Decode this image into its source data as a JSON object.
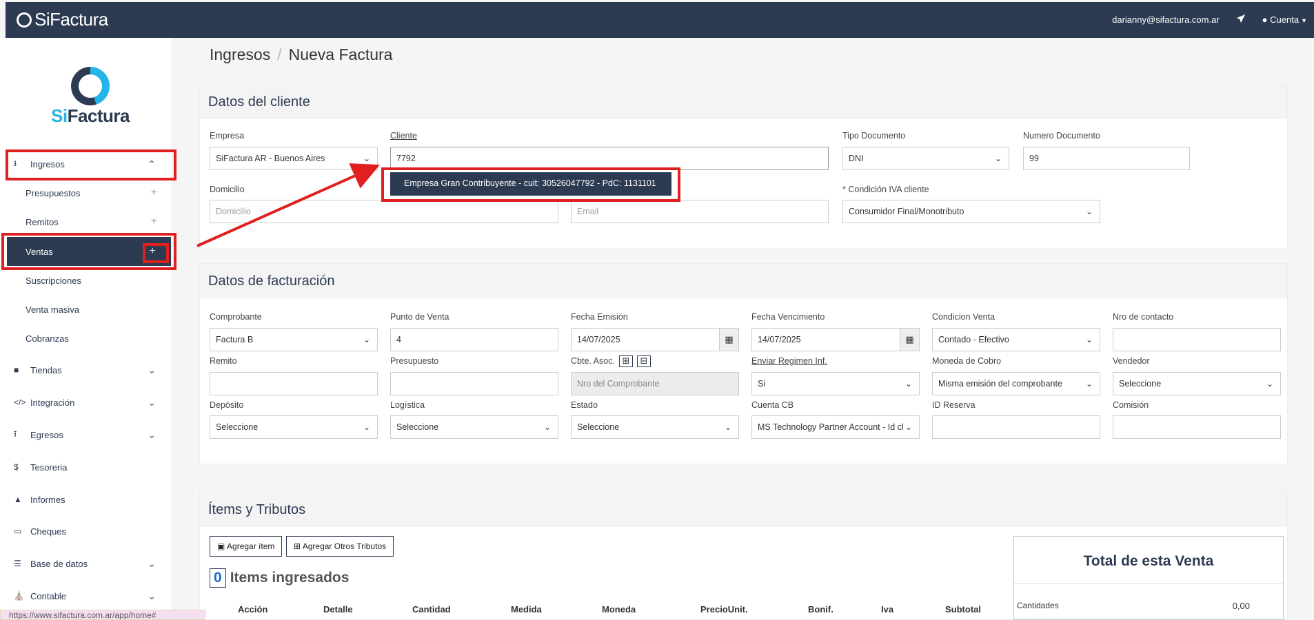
{
  "topbar": {
    "brand": "SiFactura",
    "email": "darianny@sifactura.com.ar",
    "account_label": "Cuenta"
  },
  "sidebar": {
    "logo_si": "Si",
    "logo_rest": "Factura",
    "items": [
      {
        "label": "Ingresos"
      },
      {
        "label": "Presupuestos"
      },
      {
        "label": "Remitos"
      },
      {
        "label": "Ventas"
      },
      {
        "label": "Suscripciones"
      },
      {
        "label": "Venta masiva"
      },
      {
        "label": "Cobranzas"
      },
      {
        "label": "Tiendas"
      },
      {
        "label": "Integración"
      },
      {
        "label": "Egresos"
      },
      {
        "label": "Tesoreria"
      },
      {
        "label": "Informes"
      },
      {
        "label": "Cheques"
      },
      {
        "label": "Base de datos"
      },
      {
        "label": "Contable"
      }
    ]
  },
  "breadcrumb": {
    "parent": "Ingresos",
    "current": "Nueva Factura"
  },
  "cliente": {
    "title": "Datos del cliente",
    "empresa_label": "Empresa",
    "empresa_value": "SiFactura AR - Buenos Aires",
    "cliente_label": "Cliente",
    "cliente_value": "7792",
    "tipo_doc_label": "Tipo Documento",
    "tipo_doc_value": "DNI",
    "num_doc_label": "Numero Documento",
    "num_doc_value": "99",
    "domicilio_label": "Domicilio",
    "domicilio_placeholder": "Domicilio",
    "email_placeholder": "Email",
    "iva_label": "* Condición IVA cliente",
    "iva_value": "Consumidor Final/Monotributo",
    "suggestion_prefix": "Empresa Gran Contribuyente - cuit: 30526047792 - PdC: 1131101"
  },
  "facturacion": {
    "title": "Datos de facturación",
    "comprobante_label": "Comprobante",
    "comprobante_value": "Factura B",
    "punto_venta_label": "Punto de Venta",
    "punto_venta_value": "4",
    "fecha_emision_label": "Fecha Emisión",
    "fecha_emision_value": "14/07/2025",
    "fecha_venc_label": "Fecha Vencimiento",
    "fecha_venc_value": "14/07/2025",
    "cond_venta_label": "Condicion Venta",
    "cond_venta_value": "Contado - Efectivo",
    "nro_contacto_label": "Nro de contacto",
    "remito_label": "Remito",
    "presupuesto_label": "Presupuesto",
    "cbte_asoc_label": "Cbte. Asoc.",
    "cbte_asoc_placeholder": "Nro del Comprobante",
    "regimen_label": "Enviar Regimen Inf.",
    "regimen_value": "Si",
    "moneda_label": "Moneda de Cobro",
    "moneda_value": "Misma emisión del comprobante",
    "vendedor_label": "Vendedor",
    "vendedor_value": "Seleccione",
    "deposito_label": "Depósito",
    "deposito_value": "Seleccione",
    "logistica_label": "Logística",
    "logistica_value": "Seleccione",
    "estado_label": "Estado",
    "estado_value": "Seleccione",
    "cuenta_cb_label": "Cuenta CB",
    "cuenta_cb_value": "MS Technology Partner Account - Id cl",
    "id_reserva_label": "ID Reserva",
    "comision_label": "Comisión"
  },
  "items": {
    "title": "Ítems y Tributos",
    "add_item": "Agregar ítem",
    "add_tributos": "Agregar Otros Tributos",
    "count": "0",
    "count_label": "Items ingresados",
    "columns": [
      "Acción",
      "Detalle",
      "Cantidad",
      "Medida",
      "Moneda",
      "PrecioUnit.",
      "Bonif.",
      "Iva",
      "Subtotal"
    ]
  },
  "totals": {
    "title": "Total de esta Venta",
    "cantidades_label": "Cantidades",
    "cantidades_value": "0,00"
  },
  "statusbar": {
    "url": "https://www.sifactura.com.ar/app/home#"
  },
  "colors": {
    "navy": "#2c3a52",
    "accent": "#23b5e8",
    "highlight": "#e02020"
  }
}
